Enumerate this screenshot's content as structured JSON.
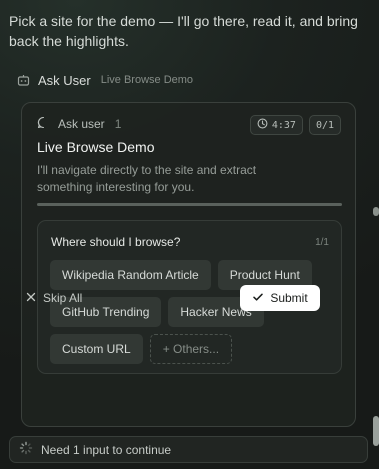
{
  "intro_message": "Pick a site for the demo — I'll go there, read it, and bring back the highlights.",
  "tool_call": {
    "name": "Ask User",
    "subtitle": "Live Browse Demo",
    "icon": "bot-icon"
  },
  "card": {
    "kind_label": "Ask user",
    "kind_count": "1",
    "timer": "4:37",
    "step": "0/1",
    "title": "Live Browse Demo",
    "description": "I'll navigate directly to the site and extract something interesting for you.",
    "progress_fraction": 1.0,
    "question": {
      "label": "Where should I browse?",
      "pager": "1/1",
      "options": [
        "Wikipedia Random Article",
        "Product Hunt",
        "GitHub Trending",
        "Hacker News",
        "Custom URL"
      ],
      "other_label": "+ Others..."
    },
    "skip_label": "Skip All",
    "submit_label": "Submit"
  },
  "status_bar": {
    "text": "Need 1 input to continue",
    "icon": "spinner-icon"
  },
  "colors": {
    "background": "#1c221f",
    "card_border": "#3a403c",
    "chip": "#323834",
    "submit_bg": "#ffffff"
  }
}
